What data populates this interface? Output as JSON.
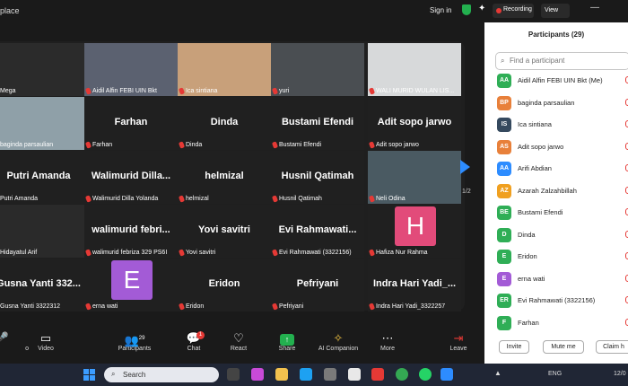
{
  "titlebar": {
    "app_title": "place",
    "sign_in": "Sign in",
    "recording": "Recording",
    "view": "View",
    "spark_icon": "✦",
    "minimize": "—"
  },
  "gallery": {
    "tiles": [
      {
        "label": "Mega"
      },
      {
        "label": "Aidil Alfin FEBI UIN Bkt"
      },
      {
        "label": "Ica sintiana"
      },
      {
        "label": "yuri"
      },
      {
        "label": "WALI MURID WULAN LIS..."
      },
      {
        "label": "baginda parsaulian"
      },
      {
        "big": "Farhan",
        "label": "Farhan"
      },
      {
        "big": "Dinda",
        "label": "Dinda"
      },
      {
        "big": "Bustami Efendi",
        "label": "Bustami Efendi"
      },
      {
        "big": "Adit sopo jarwo",
        "label": "Adit sopo jarwo"
      },
      {
        "big": "Putri Amanda",
        "label": "Putri Amanda"
      },
      {
        "big": "Walimurid  Dilla...",
        "label": "Walimurid Dilla Yolanda"
      },
      {
        "big": "helmizal",
        "label": "helmizal"
      },
      {
        "big": "Husnil Qatimah",
        "label": "Husnil Qatimah"
      },
      {
        "label": "Neli Odina"
      },
      {
        "label": "Hidayatul Arif"
      },
      {
        "big": "walimurid  febri...",
        "label": "walimurid febriza 329 PS6I"
      },
      {
        "big": "Yovi savitri",
        "label": "Yovi savitri"
      },
      {
        "big": "Evi  Rahmawati...",
        "label": "Evi Rahmawati (3322156)"
      },
      {
        "letter": "H",
        "label": "Hafiza Nur Rahma"
      },
      {
        "big": "Gusna  Yanti  332...",
        "label": "Gusna Yanti 3322312"
      },
      {
        "letter": "E",
        "label": "erna wati"
      },
      {
        "big": "Eridon",
        "label": "Eridon"
      },
      {
        "big": "Pefriyani",
        "label": "Pefriyani"
      },
      {
        "big": "Indra  Hari  Yadi_...",
        "label": "Indra Hari Yadi_3322257"
      }
    ],
    "page": "1/2"
  },
  "toolbar": {
    "audio": "o",
    "video": "Video",
    "participants": "Participants",
    "participants_count": "29",
    "chat": "Chat",
    "chat_badge": "1",
    "react": "React",
    "share": "Share",
    "ai_companion": "AI Companion",
    "more": "More",
    "leave": "Leave"
  },
  "participants_panel": {
    "title": "Participants (29)",
    "search_placeholder": "Find a participant",
    "list": [
      {
        "initials": "AA",
        "name": "Aidil Alfin FEBI UIN Bkt (Me)",
        "color": "#2fae56"
      },
      {
        "initials": "BP",
        "name": "baginda parsaulian",
        "color": "#e8803a"
      },
      {
        "initials": "IS",
        "name": "Ica sintiana",
        "color": "#35495e"
      },
      {
        "initials": "AS",
        "name": "Adit sopo jarwo",
        "color": "#e8803a"
      },
      {
        "initials": "AA",
        "name": "Arifi Abdian",
        "color": "#2d8cff"
      },
      {
        "initials": "AZ",
        "name": "Azarah Zalzahbillah",
        "color": "#f0a020"
      },
      {
        "initials": "BE",
        "name": "Bustami Efendi",
        "color": "#2fae56"
      },
      {
        "initials": "D",
        "name": "Dinda",
        "color": "#2fae56"
      },
      {
        "initials": "E",
        "name": "Eridon",
        "color": "#2fae56"
      },
      {
        "initials": "E",
        "name": "erna wati",
        "color": "#a35bd6"
      },
      {
        "initials": "ER",
        "name": "Evi Rahmawati (3322156)",
        "color": "#2fae56"
      },
      {
        "initials": "F",
        "name": "Farhan",
        "color": "#2fae56"
      }
    ],
    "invite": "Invite",
    "mute_me": "Mute me",
    "claim_host": "Claim h"
  },
  "taskbar": {
    "search_text": "Search",
    "lang": "ENG",
    "clock": "12/0"
  }
}
